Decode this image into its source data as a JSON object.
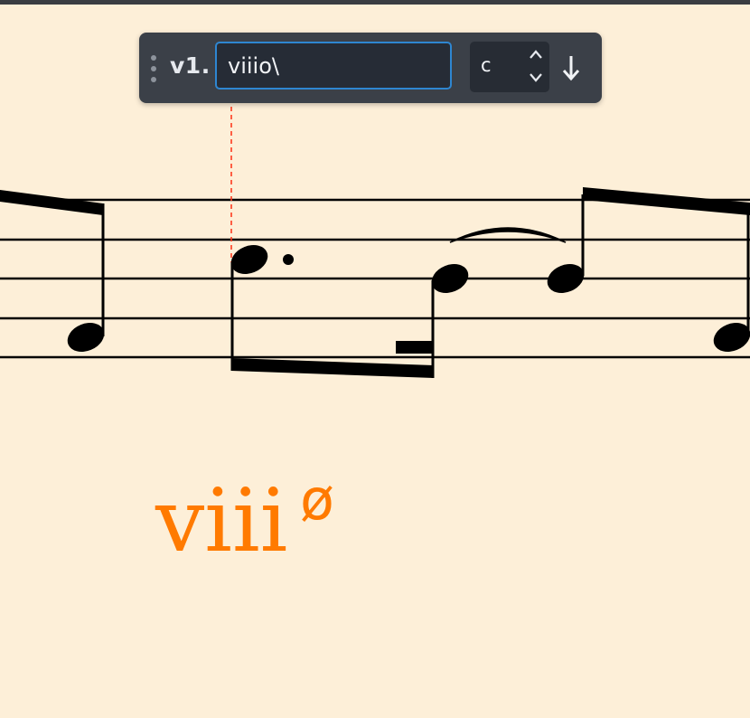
{
  "popup": {
    "verse_label": "v1.",
    "chord_input_value": "viiio\\",
    "variant_value": "c",
    "variant_up_icon": "chevron-up-icon",
    "variant_down_icon": "chevron-down-icon",
    "apply_icon": "arrow-down-icon",
    "grip_icon": "vertical-ellipsis-icon"
  },
  "chord": {
    "roman": "viii",
    "quality": "ø"
  },
  "colors": {
    "paper": "#fdefd8",
    "accent_orange": "#ff7a00",
    "guide_red": "#ff3b1f",
    "popup_bg": "#3b4048",
    "input_border": "#2e86d1"
  }
}
